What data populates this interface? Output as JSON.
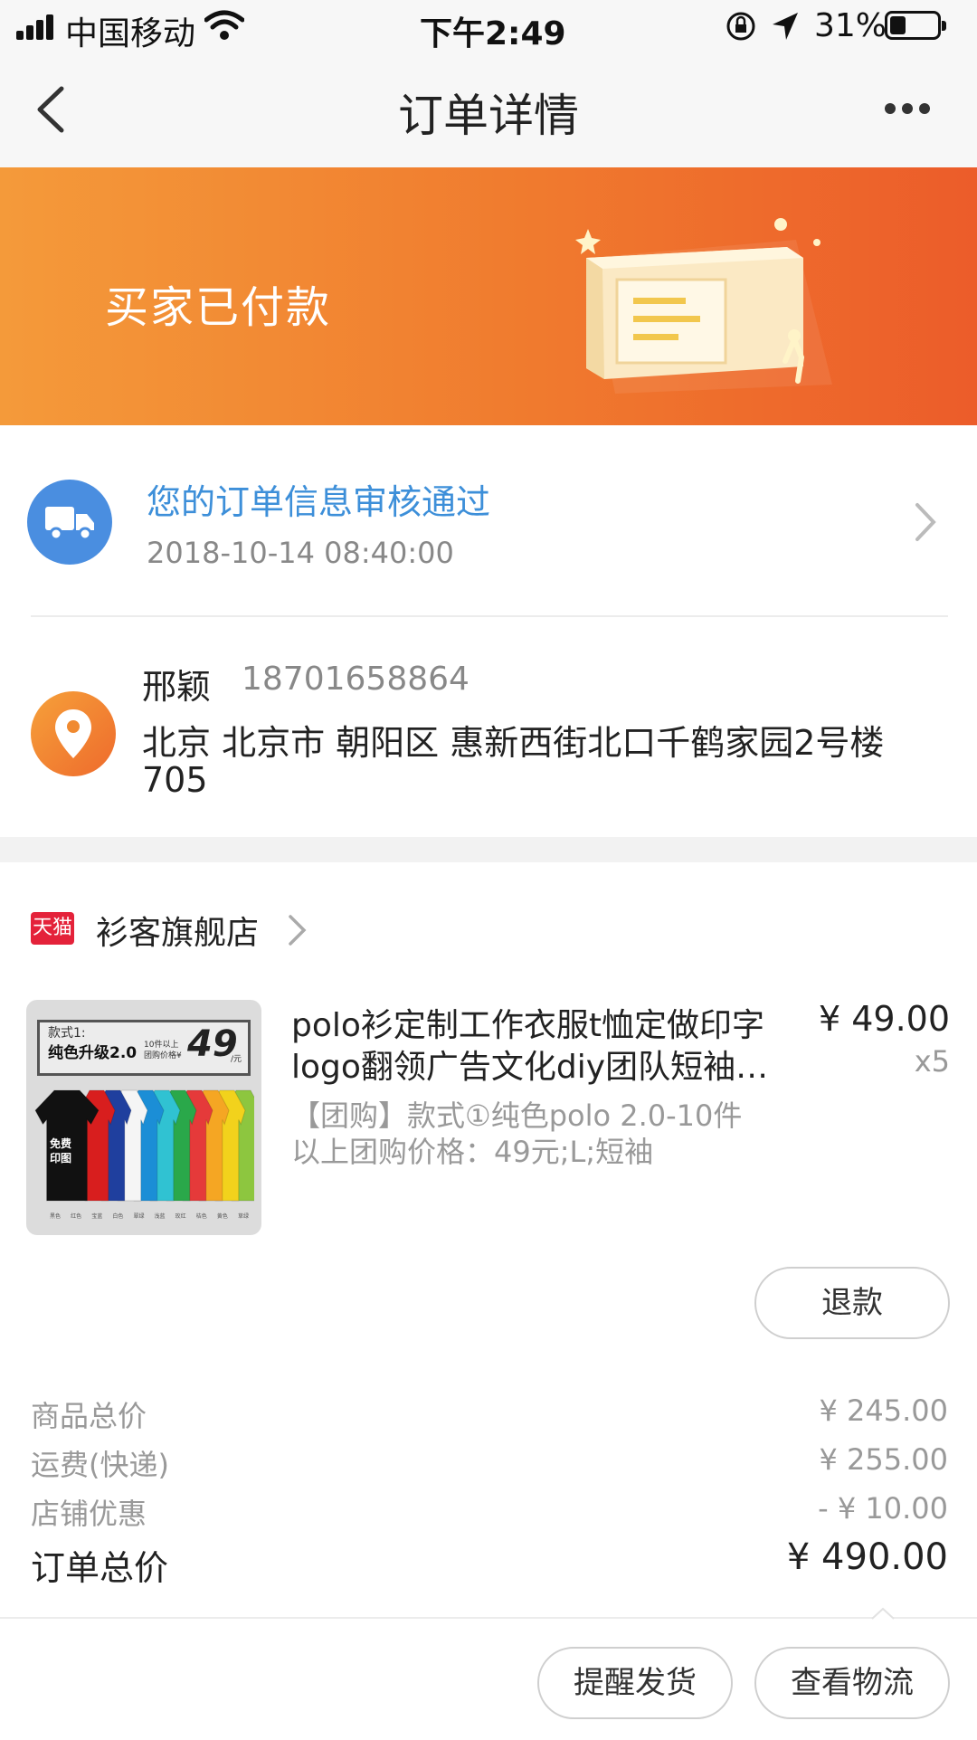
{
  "status_bar": {
    "carrier": "中国移动",
    "time": "下午2:49",
    "battery": "31%"
  },
  "nav": {
    "title": "订单详情"
  },
  "banner": {
    "status": "买家已付款"
  },
  "logistics": {
    "message": "您的订单信息审核通过",
    "timestamp": "2018-10-14 08:40:00"
  },
  "address": {
    "name": "邢颖",
    "phone": "18701658864",
    "line1": "北京 北京市 朝阳区 惠新西街北口千鹤家园2号楼",
    "line2": "705"
  },
  "store": {
    "badge": "天猫",
    "name": "衫客旗舰店"
  },
  "product": {
    "title_line1": "polo衫定制工作衣服t恤定做印字",
    "title_line2": "logo翻领广告文化diy团队短袖…",
    "price": "¥ 49.00",
    "quantity": "x5",
    "spec_line1": "【团购】款式①纯色polo 2.0-10件",
    "spec_line2": "以上团购价格：49元;L;短袖",
    "image": {
      "label_top": "款式1:",
      "label_main": "纯色升级2.0",
      "label_small1": "10件以上",
      "label_small2": "团购价格¥",
      "big_price": "49",
      "unit": "/元",
      "shirt_text1": "免费",
      "shirt_text2": "印图",
      "shirt_colors": [
        "#111111",
        "#d81e1e",
        "#1f3f9e",
        "#f5f5f5",
        "#1b8ed6",
        "#30c2d2",
        "#2aa84a",
        "#e53a3a",
        "#f5a623",
        "#f2d21c",
        "#8dc63f"
      ],
      "color_names": [
        "黑色",
        "红色",
        "宝蓝",
        "白色",
        "翠绿",
        "浅蓝",
        "玫红",
        "桔色",
        "黄色",
        "草绿"
      ]
    }
  },
  "refund_button": "退款",
  "summary": {
    "rows": [
      {
        "label": "商品总价",
        "value": "¥ 245.00"
      },
      {
        "label": "运费(快递)",
        "value": "¥ 255.00"
      },
      {
        "label": "店铺优惠",
        "value": "- ¥ 10.00"
      }
    ],
    "total_label": "订单总价",
    "total_value": "¥ 490.00"
  },
  "footer": {
    "remind_button": "提醒发货",
    "logistics_button": "查看物流"
  },
  "colors": {
    "accent_orange": "#f07a2e",
    "link_blue": "#3d8fd9",
    "tmall_red": "#e4223a"
  }
}
